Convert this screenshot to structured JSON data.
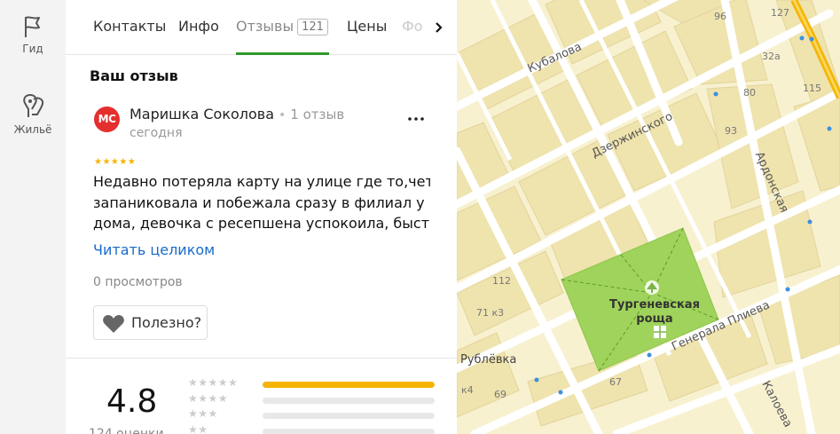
{
  "rail": {
    "guide_label": "Гид",
    "housing_label": "Жильё"
  },
  "tabs": {
    "items": [
      {
        "label": "Контакты"
      },
      {
        "label": "Инфо"
      },
      {
        "label": "Отзывы",
        "count": "121"
      },
      {
        "label": "Цены"
      },
      {
        "label": "Фо"
      }
    ],
    "active_index": 2
  },
  "review": {
    "section_title": "Ваш отзыв",
    "avatar_initials": "МС",
    "author": "Маришка Соколова",
    "author_meta": "1 отзыв",
    "date": "сегодня",
    "stars": "★★★★★",
    "rating": 5,
    "text_lines": [
      "Недавно потеряла карту на улице где то,чет",
      "запаниковала и побежала сразу в филиал у",
      "дома, девочка с ресепшена успокоила, быст…"
    ],
    "read_more": "Читать целиком",
    "views": "0 просмотров",
    "useful_label": "Полезно?"
  },
  "summary": {
    "rating": "4.8",
    "count_label": "124 оценки",
    "distribution": [
      {
        "stars": "★★★★★",
        "fraction": 1.0
      },
      {
        "stars": "★★★★",
        "fraction": 0.0
      },
      {
        "stars": "★★★",
        "fraction": 0.0
      },
      {
        "stars": "★★",
        "fraction": 0.0
      }
    ]
  },
  "map": {
    "labels": {
      "kubalova": "Кубалова",
      "dzerzhinskogo": "Дзержинского",
      "ardonskaya": "Ардонская",
      "park": "Тургеневская\nроща",
      "park_line1": "Тургеневская",
      "park_line2": "роща",
      "generala_plieva": "Генерала Плиева",
      "rublevka": "Рублёвка",
      "kaloeva": "Калоева"
    },
    "house_numbers": [
      "96",
      "127",
      "32а",
      "80",
      "115",
      "93",
      "112",
      "71 к3",
      "67",
      "к4",
      "69"
    ],
    "colors": {
      "background": "#f8f1d0",
      "park": "#9fd35b",
      "road": "#ffffff",
      "highway": "#f5b400",
      "block": "#efe3ae"
    }
  }
}
